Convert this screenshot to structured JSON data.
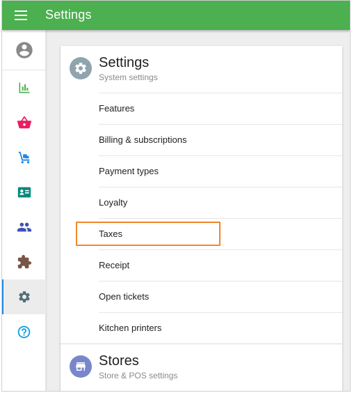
{
  "app": {
    "title": "Settings"
  },
  "colors": {
    "header": "#4caf50",
    "highlight": "#f0872a",
    "settings_icon_bg": "#90a4ae",
    "stores_icon_bg": "#7986cb"
  },
  "sidebar": {
    "items": [
      {
        "icon": "account-circle-icon",
        "color": "#8a8a8a"
      },
      {
        "icon": "bar-chart-icon",
        "color": "#4caf50"
      },
      {
        "icon": "shopping-basket-icon",
        "color": "#e91e63"
      },
      {
        "icon": "dolly-cart-icon",
        "color": "#1e88e5"
      },
      {
        "icon": "contact-card-icon",
        "color": "#00897b"
      },
      {
        "icon": "people-icon",
        "color": "#3f51b5"
      },
      {
        "icon": "puzzle-piece-icon",
        "color": "#795548"
      },
      {
        "icon": "gear-icon",
        "color": "#546e7a",
        "active": true
      },
      {
        "icon": "help-circle-icon",
        "color": "#039be5"
      }
    ]
  },
  "settings_section": {
    "title": "Settings",
    "subtitle": "System settings",
    "icon": "gear-icon",
    "items": [
      {
        "label": "Features"
      },
      {
        "label": "Billing & subscriptions"
      },
      {
        "label": "Payment types"
      },
      {
        "label": "Loyalty"
      },
      {
        "label": "Taxes",
        "highlighted": true
      },
      {
        "label": "Receipt"
      },
      {
        "label": "Open tickets"
      },
      {
        "label": "Kitchen printers"
      }
    ]
  },
  "stores_section": {
    "title": "Stores",
    "subtitle": "Store & POS settings",
    "icon": "store-icon"
  }
}
